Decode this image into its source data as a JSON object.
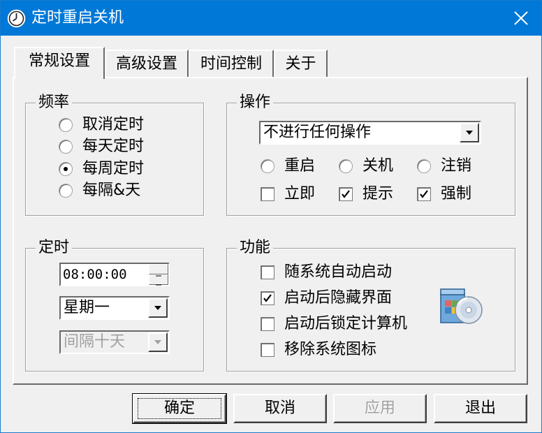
{
  "window": {
    "title": "定时重启关机",
    "icon": "clock-icon",
    "close_icon": "close-icon",
    "titlebar_color": "#0078d7"
  },
  "tabs": [
    {
      "label": "常规设置",
      "active": true
    },
    {
      "label": "高级设置",
      "active": false
    },
    {
      "label": "时间控制",
      "active": false
    },
    {
      "label": "关于",
      "active": false
    }
  ],
  "frequency": {
    "title": "频率",
    "options": [
      {
        "label": "取消定时",
        "checked": false
      },
      {
        "label": "每天定时",
        "checked": false
      },
      {
        "label": "每周定时",
        "checked": true
      },
      {
        "label": "每隔&天",
        "checked": false
      }
    ]
  },
  "operation": {
    "title": "操作",
    "select_value": "不进行任何操作",
    "actions": [
      {
        "label": "重启",
        "checked": false
      },
      {
        "label": "关机",
        "checked": false
      },
      {
        "label": "注销",
        "checked": false
      }
    ],
    "flags": [
      {
        "label": "立即",
        "checked": false
      },
      {
        "label": "提示",
        "checked": true
      },
      {
        "label": "强制",
        "checked": true
      }
    ]
  },
  "timing": {
    "title": "定时",
    "time_value": "08:00:00",
    "weekday_value": "星期一",
    "interval_value": "间隔十天",
    "interval_disabled": true
  },
  "features": {
    "title": "功能",
    "options": [
      {
        "label": "随系统自动启动",
        "checked": false
      },
      {
        "label": "启动后隐藏界面",
        "checked": true
      },
      {
        "label": "启动后锁定计算机",
        "checked": false
      },
      {
        "label": "移除系统图标",
        "checked": false
      }
    ],
    "illustration_icon": "install-disc-icon"
  },
  "buttons": {
    "ok": "确定",
    "cancel": "取消",
    "apply": "应用",
    "exit": "退出"
  }
}
